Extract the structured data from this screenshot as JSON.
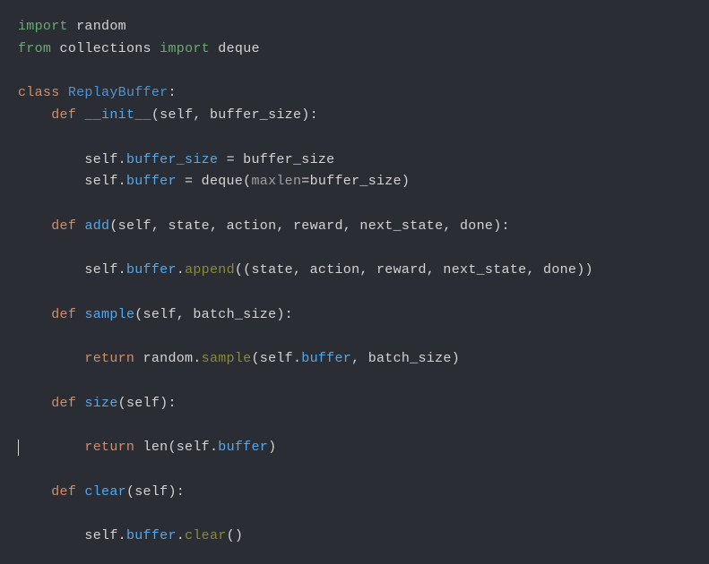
{
  "code": {
    "line1": {
      "import_kw": "import",
      "module": "random"
    },
    "line2": {
      "from_kw": "from",
      "module": "collections",
      "import_kw": "import",
      "name": "deque"
    },
    "line4": {
      "class_kw": "class",
      "class_name": "ReplayBuffer",
      "colon": ":"
    },
    "line5": {
      "def_kw": "def",
      "fn_name": "__init__",
      "params": "(self, buffer_size):"
    },
    "line7": {
      "prefix": "self.",
      "attr": "buffer_size",
      "assign": " = buffer_size"
    },
    "line8": {
      "prefix": "self.",
      "attr": "buffer",
      "assign_eq": " = ",
      "call": "deque(",
      "kwarg": "maxlen",
      "rest": "=buffer_size)"
    },
    "line10": {
      "def_kw": "def",
      "fn_name": "add",
      "params": "(self, state, action, reward, next_state, done):"
    },
    "line12": {
      "prefix": "self.",
      "attr": "buffer",
      "dot": ".",
      "method": "append",
      "args": "((state, action, reward, next_state, done))"
    },
    "line14": {
      "def_kw": "def",
      "fn_name": "sample",
      "params": "(self, batch_size):"
    },
    "line16": {
      "return_kw": "return",
      "prefix": " random.",
      "method": "sample",
      "open": "(self.",
      "attr": "buffer",
      "rest": ", batch_size)"
    },
    "line18": {
      "def_kw": "def",
      "fn_name": "size",
      "params": "(self):"
    },
    "line20": {
      "return_kw": "return",
      "prefix": " ",
      "call": "len(self.",
      "attr": "buffer",
      "close": ")"
    },
    "line22": {
      "def_kw": "def",
      "fn_name": "clear",
      "params": "(self):"
    },
    "line24": {
      "prefix": "self.",
      "attr": "buffer",
      "dot": ".",
      "method": "clear",
      "args": "()"
    }
  }
}
